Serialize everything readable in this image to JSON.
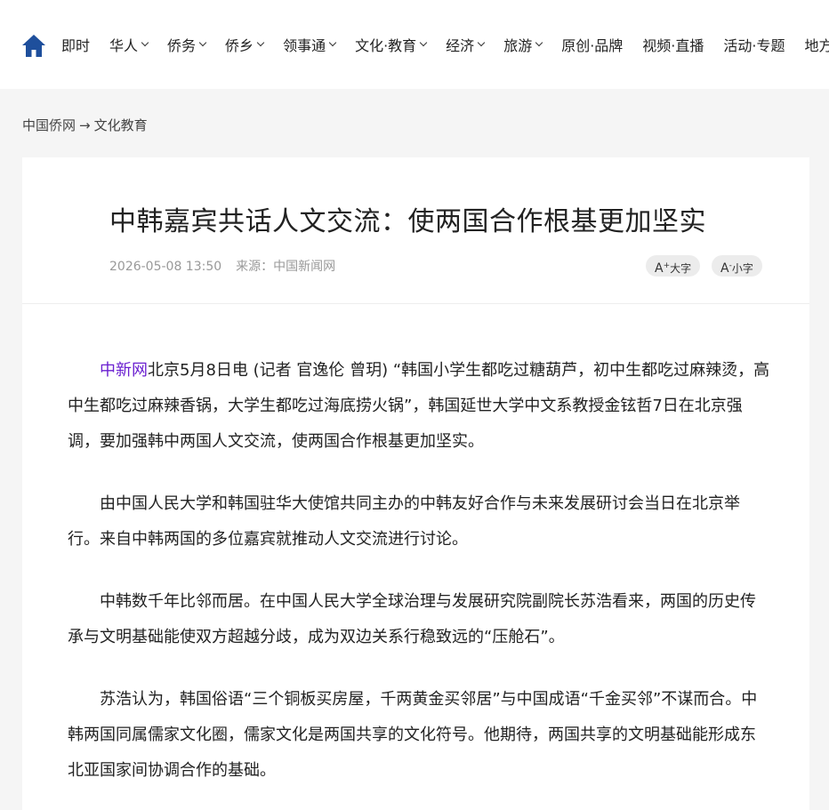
{
  "nav": {
    "items": [
      {
        "label": "即时",
        "has_dropdown": false
      },
      {
        "label": "华人",
        "has_dropdown": true
      },
      {
        "label": "侨务",
        "has_dropdown": true
      },
      {
        "label": "侨乡",
        "has_dropdown": true
      },
      {
        "label": "领事通",
        "has_dropdown": true
      },
      {
        "label": "文化·教育",
        "has_dropdown": true
      },
      {
        "label": "经济",
        "has_dropdown": true
      },
      {
        "label": "旅游",
        "has_dropdown": true
      },
      {
        "label": "原创·品牌",
        "has_dropdown": false
      },
      {
        "label": "视频·直播",
        "has_dropdown": false
      },
      {
        "label": "活动·专题",
        "has_dropdown": false
      },
      {
        "label": "地方",
        "has_dropdown": false
      }
    ]
  },
  "breadcrumb": {
    "home": "中国侨网",
    "separator": "→",
    "section": "文化教育"
  },
  "article": {
    "title": "中韩嘉宾共话人文交流：使两国合作根基更加坚实",
    "datetime": "2026-05-08 13:50",
    "source": "来源：中国新闻网",
    "font_large": {
      "glyph": "A",
      "mark": "+",
      "label": "大字"
    },
    "font_small": {
      "glyph": "A",
      "mark": "-",
      "label": "小字"
    },
    "paragraphs": [
      {
        "link": "中新网",
        "text": "北京5月8日电 (记者 官逸伦 曾玥) “韩国小学生都吃过糖葫芦，初中生都吃过麻辣烫，高中生都吃过麻辣香锅，大学生都吃过海底捞火锅”，韩国延世大学中文系教授金铉哲7日在北京强调，要加强韩中两国人文交流，使两国合作根基更加坚实。"
      },
      {
        "link": "",
        "text": "由中国人民大学和韩国驻华大使馆共同主办的中韩友好合作与未来发展研讨会当日在北京举行。来自中韩两国的多位嘉宾就推动人文交流进行讨论。"
      },
      {
        "link": "",
        "text": "中韩数千年比邻而居。在中国人民大学全球治理与发展研究院副院长苏浩看来，两国的历史传承与文明基础能使双方超越分歧，成为双边关系行稳致远的“压舱石”。"
      },
      {
        "link": "",
        "text": "苏浩认为，韩国俗语“三个铜板买房屋，千两黄金买邻居”与中国成语“千金买邻”不谋而合。中韩两国同属儒家文化圈，儒家文化是两国共享的文化符号。他期待，两国共享的文明基础能形成东北亚国家间协调合作的基础。"
      }
    ]
  },
  "colors": {
    "brand_blue": "#1e4f9c",
    "link_purple": "#6a1fd0"
  }
}
